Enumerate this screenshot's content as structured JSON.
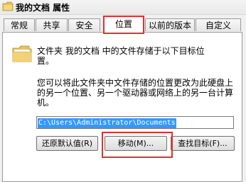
{
  "window": {
    "title": "我的文档 属性"
  },
  "tabs": [
    {
      "label": "常规"
    },
    {
      "label": "共享"
    },
    {
      "label": "安全"
    },
    {
      "label": "位置",
      "active": true
    },
    {
      "label": "以前的版本"
    },
    {
      "label": "自定义"
    }
  ],
  "location": {
    "description_line1": "文件夹 我的文档 中的文件存储于以下目标位",
    "description_line2": "置。",
    "info_line1": "您可以将此文件夹中文件存储的位置更改为此硬盘上",
    "info_line2": "的另一个位置、另一个驱动器或网络上的另一台计算",
    "info_line3": "机。",
    "path_value": "C:\\Users\\Administrator\\Documents"
  },
  "buttons": {
    "restore_default": "还原默认值(R)",
    "move": "移动(M)...",
    "find_target": "查找目标(F)..."
  },
  "colors": {
    "highlight": "#e03030",
    "selection": "#3399ff"
  }
}
